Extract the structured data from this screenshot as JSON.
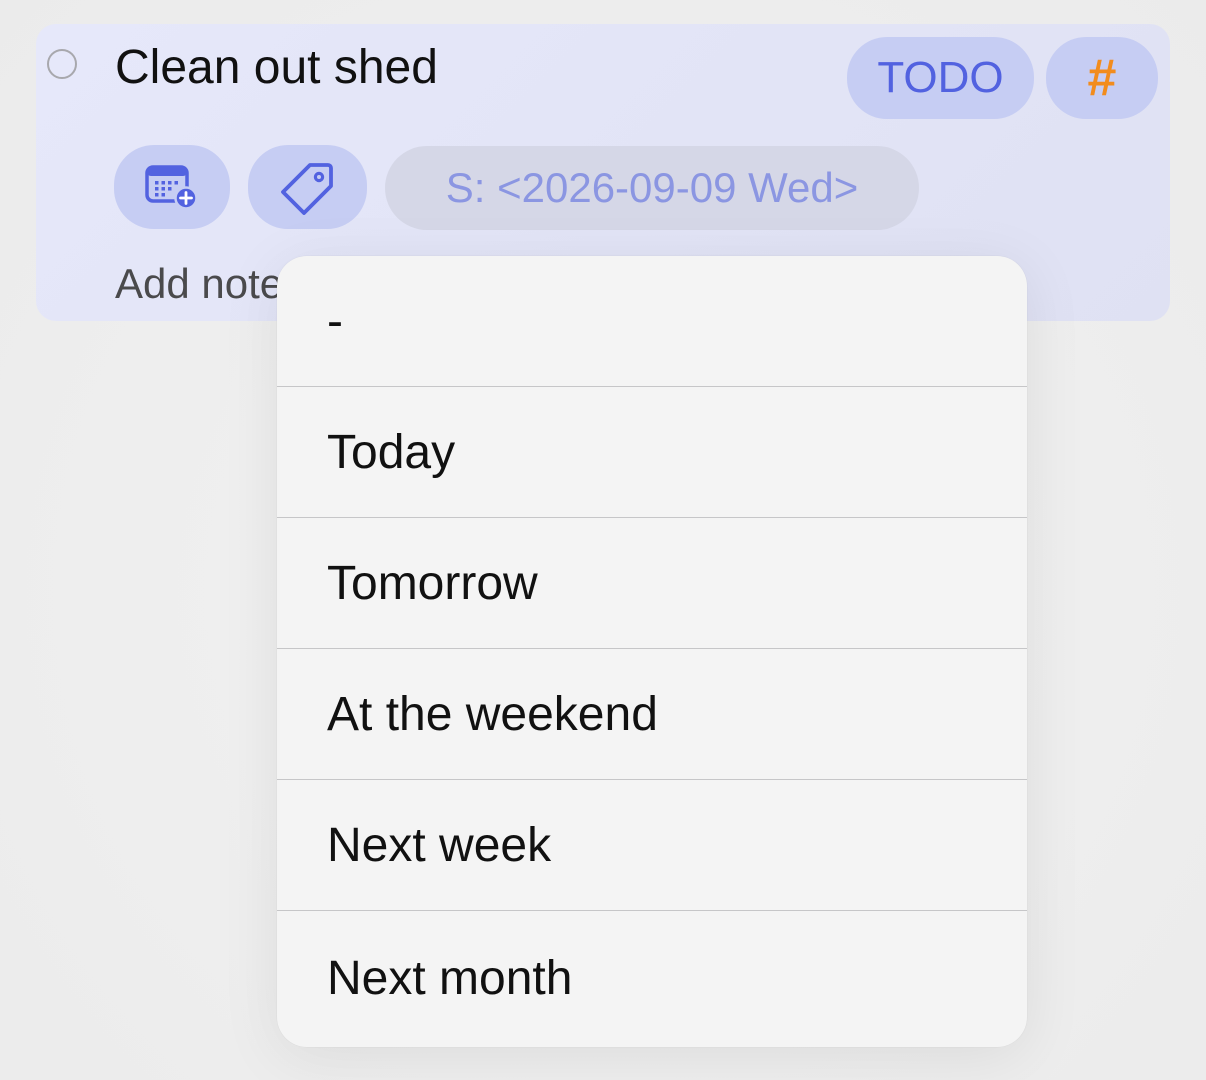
{
  "task": {
    "title": "Clean out shed",
    "state": "TODO",
    "tag_symbol": "#",
    "scheduled": "S: <2026-09-09 Wed>",
    "note_placeholder": "Add note"
  },
  "icons": {
    "checkbox": "circle-outline-icon",
    "calendar": "calendar-plus-icon",
    "tag": "tag-icon"
  },
  "menu": {
    "items": [
      {
        "label": "-"
      },
      {
        "label": "Today"
      },
      {
        "label": "Tomorrow"
      },
      {
        "label": "At the weekend"
      },
      {
        "label": "Next week"
      },
      {
        "label": "Next month"
      }
    ]
  },
  "colors": {
    "accent": "#5262E0",
    "tag": "#F28C1D",
    "card_bg": "#E3E5F7",
    "pill_bg": "#C6CDF3"
  }
}
